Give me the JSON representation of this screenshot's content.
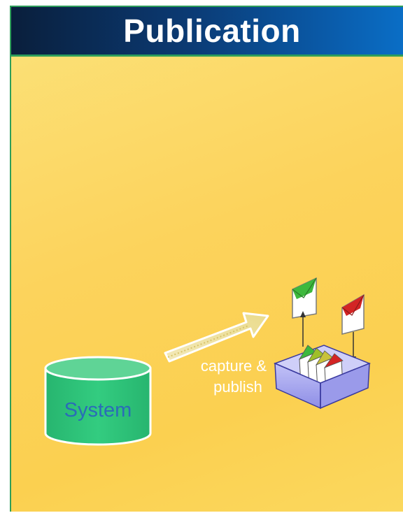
{
  "title": "Publication",
  "cylinder": {
    "label": "System",
    "fill": "#2cc47a",
    "top_fill": "#5fd496",
    "label_color": "#2a6cb8"
  },
  "arrow": {
    "label_line1": "capture &",
    "label_line2": "publish"
  },
  "envelopes": {
    "outgoing": {
      "flag_color": "#3db83d"
    },
    "incoming": {
      "flag_color": "#d32424"
    }
  },
  "tray": {
    "fill": "#a6a6f0",
    "stroke": "#3a3aa0"
  },
  "folders": [
    "#3db83d",
    "#9fbf2a",
    "#c8c23a",
    "#d32424"
  ]
}
